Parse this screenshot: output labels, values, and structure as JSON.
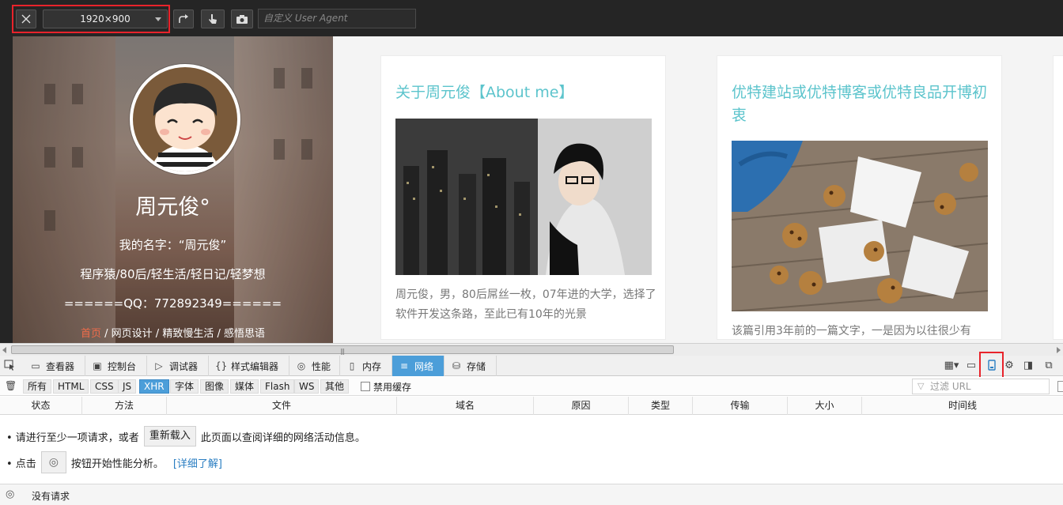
{
  "rdm_toolbar": {
    "close_icon": "close-icon",
    "viewport_size": "1920×900",
    "rotate_icon": "rotate-icon",
    "touch_icon": "touch-icon",
    "screenshot_icon": "camera-icon",
    "user_agent_placeholder": "自定义 User Agent"
  },
  "page": {
    "hero": {
      "name": "周元俊°",
      "lines": [
        "我的名字：“周元俊”",
        "程序猿/80后/轻生活/轻日记/轻梦想",
        "======QQ：772892349======"
      ],
      "nav": [
        {
          "label": "首页",
          "active": true
        },
        {
          "label": "网页设计",
          "active": false
        },
        {
          "label": "精致慢生活",
          "active": false
        },
        {
          "label": "感悟思语",
          "active": false
        }
      ],
      "nav_separator": " / "
    },
    "cards": [
      {
        "title": "关于周元俊【About me】",
        "text": "周元俊，男，80后屌丝一枚，07年进的大学，选择了软件开发这条路，至此已有10年的光景"
      },
      {
        "title": "优特建站或优特博客或优特良品开博初衷",
        "text": "该篇引用3年前的一篇文字，一是因为以往很少有"
      }
    ]
  },
  "devtools": {
    "tabs": [
      {
        "label": "查看器",
        "icon": "inspector-icon"
      },
      {
        "label": "控制台",
        "icon": "console-icon"
      },
      {
        "label": "调试器",
        "icon": "debugger-icon"
      },
      {
        "label": "样式编辑器",
        "icon": "style-editor-icon"
      },
      {
        "label": "性能",
        "icon": "performance-icon"
      },
      {
        "label": "内存",
        "icon": "memory-icon"
      },
      {
        "label": "网络",
        "icon": "network-icon",
        "active": true
      },
      {
        "label": "存储",
        "icon": "storage-icon"
      }
    ],
    "filters": [
      "所有",
      "HTML",
      "CSS",
      "JS",
      "XHR",
      "字体",
      "图像",
      "媒体",
      "Flash",
      "WS",
      "其他"
    ],
    "active_filter": "XHR",
    "disable_cache_label": "禁用缓存",
    "url_filter_placeholder": "过滤 URL",
    "columns": [
      "状态",
      "方法",
      "文件",
      "域名",
      "原因",
      "类型",
      "传输",
      "大小",
      "时间线"
    ],
    "notice": {
      "line1_prefix": "• 请进行至少一项请求，或者",
      "reload_button": "重新载入",
      "line1_suffix": "此页面以查阅详细的网络活动信息。",
      "line2_prefix": "• 点击",
      "line2_suffix": "按钮开始性能分析。",
      "learn_more": "[详细了解]"
    },
    "status": "没有请求"
  },
  "colors": {
    "accent": "#4c9ed9",
    "highlight": "#e8232b",
    "card_title": "#5cc4cc",
    "nav_active": "#f06c4a"
  }
}
